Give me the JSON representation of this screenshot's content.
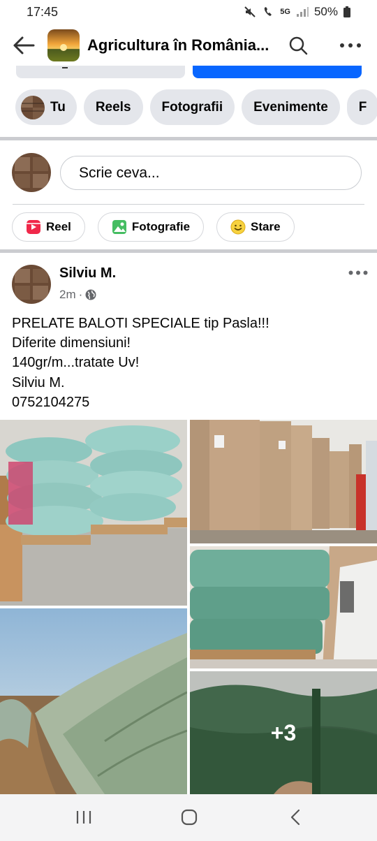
{
  "status_bar": {
    "time": "17:45",
    "network": "5G",
    "battery": "50%"
  },
  "app_bar": {
    "title": "Agricultura în România..."
  },
  "tabs": [
    {
      "label": "Tu"
    },
    {
      "label": "Reels"
    },
    {
      "label": "Fotografii"
    },
    {
      "label": "Evenimente"
    },
    {
      "label": "F"
    }
  ],
  "composer": {
    "placeholder": "Scrie ceva..."
  },
  "composer_actions": [
    {
      "label": "Reel",
      "icon": "reel-icon"
    },
    {
      "label": "Fotografie",
      "icon": "photo-icon"
    },
    {
      "label": "Stare",
      "icon": "smiley-icon"
    }
  ],
  "post": {
    "author": "Silviu M.",
    "time": "2m",
    "privacy_icon": "globe-icon",
    "lines": [
      "PRELATE BALOTI SPECIALE tip Pasla!!!",
      "Diferite dimensiuni!",
      "140gr/m...tratate Uv!",
      "Silviu M.",
      "0752104275"
    ],
    "more_photos": "+3"
  },
  "colors": {
    "brand_blue": "#0866ff",
    "chip_gray": "#e4e6eb",
    "meta_gray": "#65676b"
  }
}
